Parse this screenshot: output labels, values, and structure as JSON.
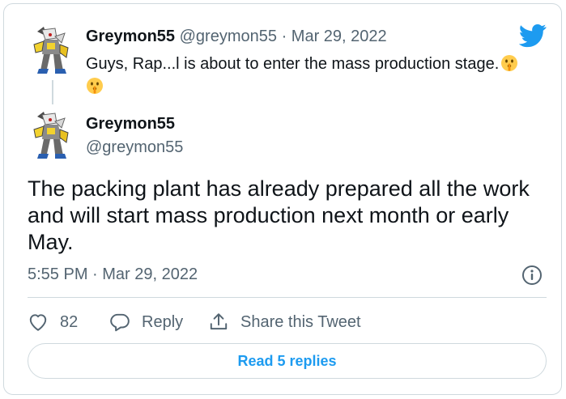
{
  "parent_tweet": {
    "name": "Greymon55",
    "handle": "@greymon55",
    "separator": "·",
    "date": "Mar 29, 2022",
    "text": "Guys, Rap...l is about to enter the mass production stage."
  },
  "main_tweet": {
    "name": "Greymon55",
    "handle": "@greymon55",
    "text": "The packing plant has already prepared all the work and will start mass production next month or early May.",
    "timestamp": "5:55 PM · Mar 29, 2022"
  },
  "actions": {
    "like_count": "82",
    "reply_label": "Reply",
    "share_label": "Share this Tweet"
  },
  "read_replies_label": "Read 5 replies",
  "icons": {
    "brand": "twitter-bird-icon",
    "emoji": "shushing-face-emoji",
    "like": "heart-icon",
    "reply": "speech-bubble-icon",
    "share": "share-upload-icon",
    "info": "info-icon"
  },
  "colors": {
    "brand_blue": "#1d9bf0",
    "text": "#0f1419",
    "muted": "#536471",
    "border": "#cfd9de"
  }
}
